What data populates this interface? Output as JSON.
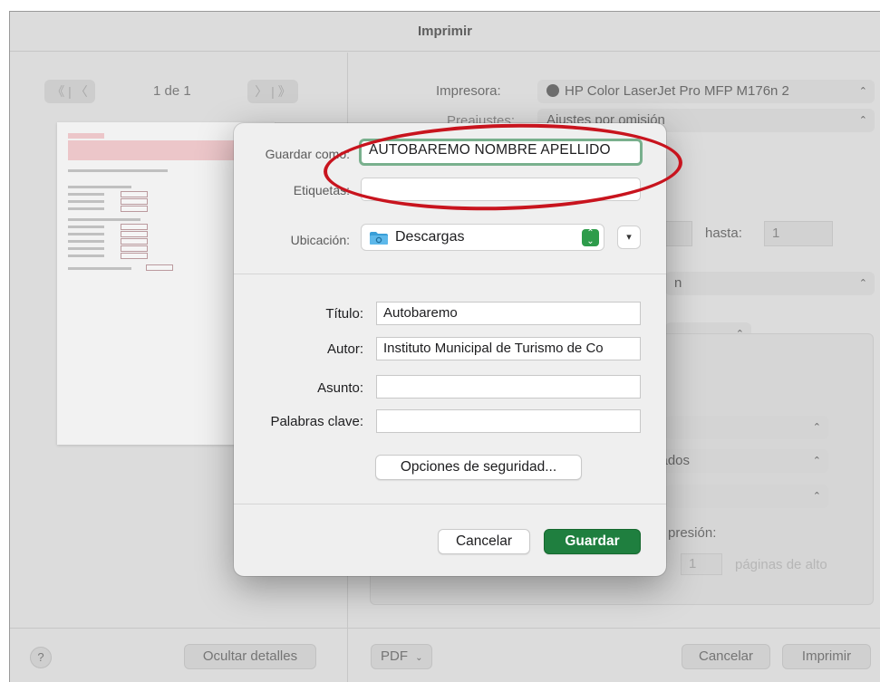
{
  "print_dialog": {
    "title": "Imprimir",
    "pager": {
      "prev_label": "《 | 〈",
      "text": "1 de 1",
      "next_label": "〉 | 》"
    },
    "printer_label": "Impresora:",
    "printer_value": "HP Color LaserJet Pro MFP M176n 2",
    "presets_label": "Preajustes:",
    "presets_value": "Ajustes por omisión",
    "range_to_label": "hasta:",
    "range_to_value": "1",
    "select_partial_1": "n",
    "select_partial_2": "zados",
    "print_partial_label": "presión:",
    "pages_field_value": "1",
    "pages_high_label": "páginas de alto",
    "help_label": "?",
    "hide_details_label": "Ocultar detalles",
    "pdf_label": "PDF",
    "cancel_label": "Cancelar",
    "print_label": "Imprimir"
  },
  "save_sheet": {
    "save_as_label": "Guardar como:",
    "save_as_value": "AUTOBAREMO NOMBRE APELLIDO",
    "tags_label": "Etiquetas:",
    "tags_value": "",
    "location_label": "Ubicación:",
    "location_value": "Descargas",
    "title_label": "Título:",
    "title_value": "Autobaremo",
    "author_label": "Autor:",
    "author_value": "Instituto Municipal de Turismo de Co",
    "subject_label": "Asunto:",
    "subject_value": "",
    "keywords_label": "Palabras clave:",
    "keywords_value": "",
    "security_options_label": "Opciones de seguridad...",
    "cancel_label": "Cancelar",
    "save_label": "Guardar"
  },
  "colors": {
    "save_button": "#1f7f3f",
    "focus_ring": "#79b08d",
    "annotation_oval": "#c8141e",
    "folder_icon": "#3a9fd8"
  },
  "icons": [
    "printer-icon",
    "stepper-icon",
    "folder-icon",
    "chevron-down-icon",
    "help-icon"
  ]
}
